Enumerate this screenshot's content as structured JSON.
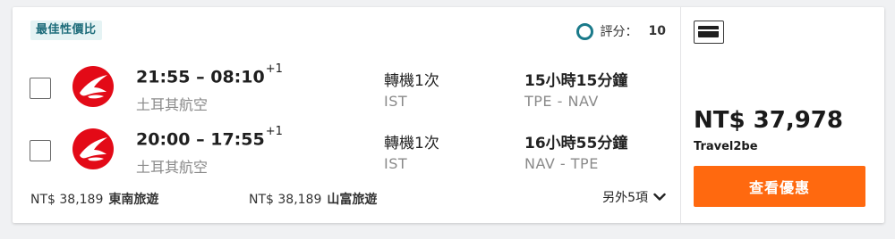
{
  "badge": "最佳性價比",
  "rating": {
    "label": "評分：",
    "value": "10"
  },
  "flights": [
    {
      "depart": "21:55",
      "arrive": "08:10",
      "day_offset": "+1",
      "airline": "土耳其航空",
      "stops": "轉機1次",
      "stop_airport": "IST",
      "duration": "15小時15分鐘",
      "route": "TPE - NAV"
    },
    {
      "depart": "20:00",
      "arrive": "17:55",
      "day_offset": "+1",
      "airline": "土耳其航空",
      "stops": "轉機1次",
      "stop_airport": "IST",
      "duration": "16小時55分鐘",
      "route": "NAV - TPE"
    }
  ],
  "other_providers": [
    {
      "price": "NT$ 38,189",
      "name": "東南旅遊"
    },
    {
      "price": "NT$ 38,189",
      "name": "山富旅遊"
    }
  ],
  "more_link": "另外5項",
  "price_panel": {
    "price": "NT$ 37,978",
    "provider": "Travel2be",
    "cta": "查看優惠",
    "card_icon": "credit-card-icon"
  },
  "colors": {
    "accent": "#ff690f",
    "badge_bg": "#e5f3f4",
    "badge_text": "#1d6c7a",
    "rating_ring": "#1a7a8a",
    "airline_red": "#e30a17"
  }
}
